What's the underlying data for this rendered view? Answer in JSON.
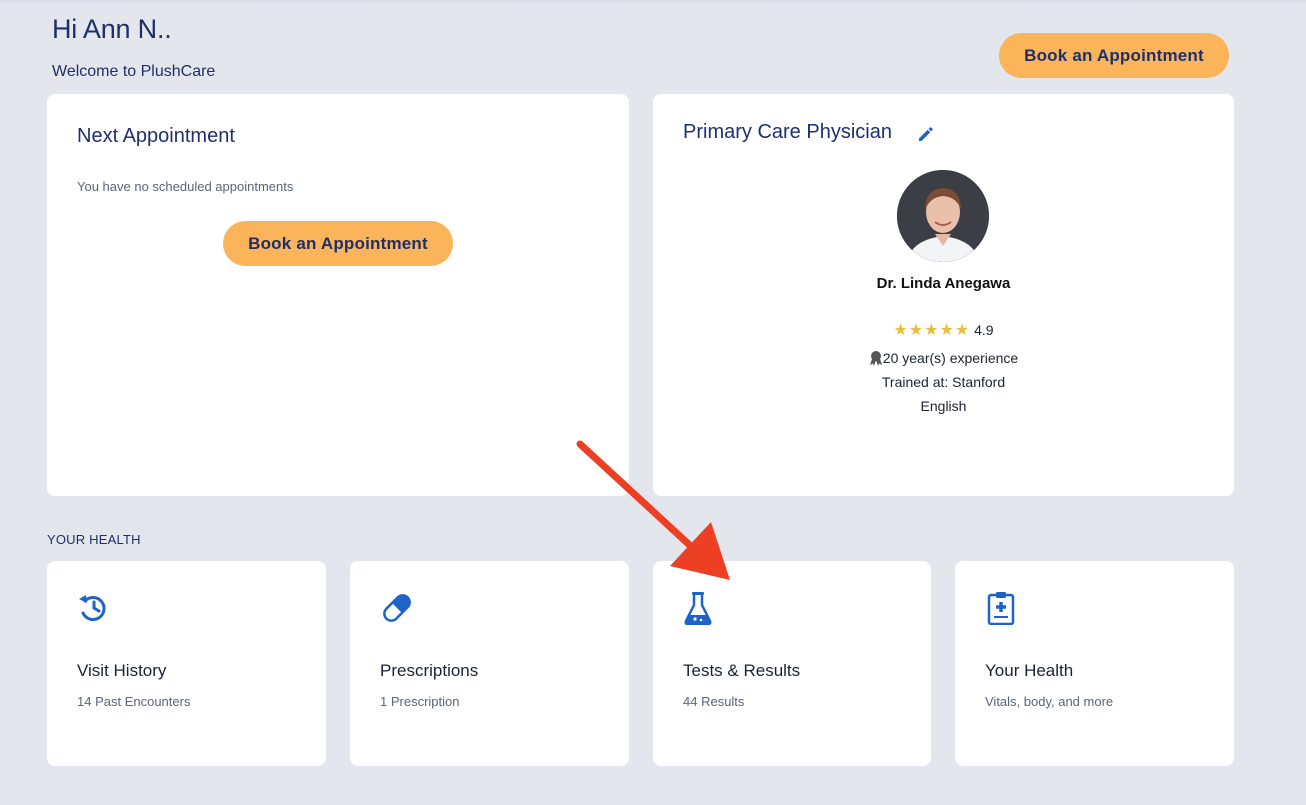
{
  "header": {
    "greeting": "Hi Ann N..",
    "welcome": "Welcome to PlushCare",
    "book_button": "Book an Appointment"
  },
  "next_appointment": {
    "title": "Next Appointment",
    "empty_text": "You have no scheduled appointments",
    "book_button": "Book an Appointment"
  },
  "physician": {
    "title": "Primary Care Physician",
    "edit_icon": "pencil-icon",
    "name": "Dr. Linda Anegawa",
    "stars": "★★★★★",
    "rating": "4.9",
    "experience": "20 year(s) experience",
    "trained": "Trained at: Stanford",
    "language": "English"
  },
  "your_health": {
    "section_label": "YOUR HEALTH",
    "tiles": [
      {
        "icon": "history-icon",
        "title": "Visit History",
        "subtitle": "14 Past Encounters"
      },
      {
        "icon": "pill-icon",
        "title": "Prescriptions",
        "subtitle": "1 Prescription"
      },
      {
        "icon": "flask-icon",
        "title": "Tests & Results",
        "subtitle": "44 Results"
      },
      {
        "icon": "clipboard-medical-icon",
        "title": "Your Health",
        "subtitle": "Vitals, body, and more"
      }
    ]
  },
  "colors": {
    "background": "#e3e6ec",
    "accent_button": "#fbb459",
    "navy_text": "#1f2f6b",
    "icon_blue": "#1d63c9",
    "annotation_arrow": "#ec3f24",
    "star_gold": "#e8be3d"
  }
}
